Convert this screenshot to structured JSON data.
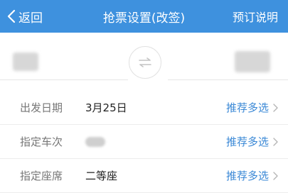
{
  "header": {
    "back_label": "返回",
    "title": "抢票设置(改签)",
    "right_label": "预订说明"
  },
  "stations": {
    "from": "",
    "to": ""
  },
  "rows": [
    {
      "label": "出发日期",
      "value": "3月25日",
      "action": "推荐多选"
    },
    {
      "label": "指定车次",
      "value": "",
      "action": "推荐多选"
    },
    {
      "label": "指定座席",
      "value": "二等座",
      "action": "推荐多选"
    }
  ],
  "colors": {
    "header_bg": "#3e91de",
    "accent": "#3a88d6"
  }
}
